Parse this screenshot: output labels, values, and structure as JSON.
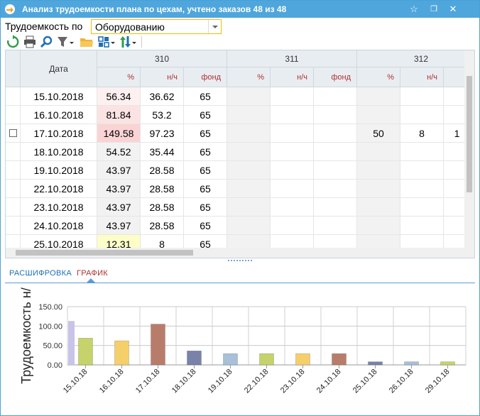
{
  "window": {
    "title": "Анализ трудоемкости плана по цехам, учтено заказов 48 из 48",
    "app_icon": "app-logo-icon",
    "buttons": [
      "pin-icon",
      "restore-icon",
      "close-icon"
    ],
    "pin_glyph": "☆",
    "restore_glyph": "❐",
    "close_glyph": "✕"
  },
  "filter": {
    "label": "Трудоемкость по",
    "selected": "Оборудованию"
  },
  "toolbar": {
    "icons": [
      "refresh-icon",
      "print-icon",
      "search-icon",
      "filter-icon",
      "folder-icon",
      "layout-icon",
      "sort-icon"
    ]
  },
  "grid": {
    "date_header": "Дата",
    "groups": [
      "310",
      "311",
      "312"
    ],
    "sub_headers": [
      "%",
      "н/ч",
      "фонд"
    ],
    "rows": [
      {
        "date": "15.10.2018",
        "c310": [
          "56.34",
          "36.62",
          "65"
        ],
        "c311": [
          "",
          "",
          ""
        ],
        "c312": [
          "",
          "",
          ""
        ],
        "hl": "#fdf0f0"
      },
      {
        "date": "16.10.2018",
        "c310": [
          "81.84",
          "53.2",
          "65"
        ],
        "c311": [
          "",
          "",
          ""
        ],
        "c312": [
          "",
          "",
          ""
        ],
        "hl": "#fbe3e3"
      },
      {
        "date": "17.10.2018",
        "c310": [
          "149.58",
          "97.23",
          "65"
        ],
        "c311": [
          "",
          "",
          ""
        ],
        "c312": [
          "50",
          "8",
          "1"
        ],
        "hl": "#fad4d4"
      },
      {
        "date": "18.10.2018",
        "c310": [
          "54.52",
          "35.44",
          "65"
        ],
        "c311": [
          "",
          "",
          ""
        ],
        "c312": [
          "",
          "",
          ""
        ],
        "hl": "#f2f2f2"
      },
      {
        "date": "19.10.2018",
        "c310": [
          "43.97",
          "28.58",
          "65"
        ],
        "c311": [
          "",
          "",
          ""
        ],
        "c312": [
          "",
          "",
          ""
        ],
        "hl": "#f2f2f2"
      },
      {
        "date": "22.10.2018",
        "c310": [
          "43.97",
          "28.58",
          "65"
        ],
        "c311": [
          "",
          "",
          ""
        ],
        "c312": [
          "",
          "",
          ""
        ],
        "hl": "#f2f2f2"
      },
      {
        "date": "23.10.2018",
        "c310": [
          "43.97",
          "28.58",
          "65"
        ],
        "c311": [
          "",
          "",
          ""
        ],
        "c312": [
          "",
          "",
          ""
        ],
        "hl": "#f2f2f2"
      },
      {
        "date": "24.10.2018",
        "c310": [
          "43.97",
          "28.58",
          "65"
        ],
        "c311": [
          "",
          "",
          ""
        ],
        "c312": [
          "",
          "",
          ""
        ],
        "hl": "#f2f2f2"
      },
      {
        "date": "25.10.2018",
        "c310": [
          "12.31",
          "8",
          "65"
        ],
        "c311": [
          "",
          "",
          ""
        ],
        "c312": [
          "",
          "",
          ""
        ],
        "hl": "#fdfdc8"
      }
    ]
  },
  "tabs": [
    {
      "label": "РАСШИФРОВКА",
      "active": false
    },
    {
      "label": "ГРАФИК",
      "active": true
    }
  ],
  "chart_data": {
    "type": "bar",
    "ylabel": "Трудоемкость н/",
    "ylim": [
      0,
      150
    ],
    "yticks": [
      "0.00",
      "50.00",
      "100.00",
      "150.00"
    ],
    "categories": [
      "15.10.18",
      "16.10.18",
      "17.10.18",
      "18.10.18",
      "19.10.18",
      "22.10.18",
      "23.10.18",
      "24.10.18",
      "25.10.18",
      "26.10.18",
      "29.10.18"
    ],
    "values": [
      69,
      62,
      105,
      36,
      29,
      29,
      29,
      29,
      8,
      8,
      8
    ],
    "colors": [
      "#c6d36a",
      "#f5cf6a",
      "#b87d6a",
      "#7982a8",
      "#a8c0d8",
      "#c6d36a",
      "#f5cf6a",
      "#b87d6a",
      "#7982a8",
      "#a8c0d8",
      "#c6d36a"
    ],
    "partial_bar": {
      "value": 113,
      "color": "#c8c3e8"
    },
    "grid": true
  }
}
